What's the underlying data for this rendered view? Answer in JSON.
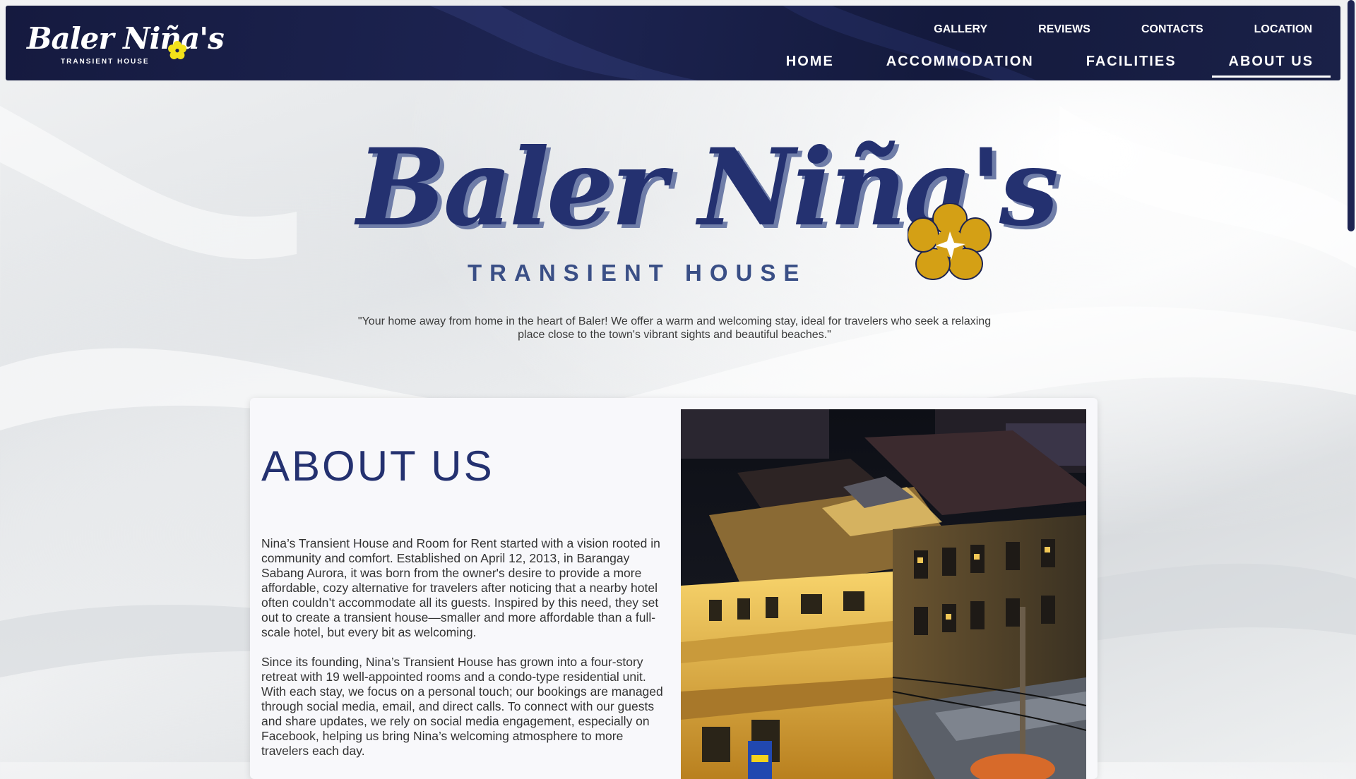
{
  "brand": {
    "small_title": "Baler Niña's",
    "small_subtitle": "TRANSIENT HOUSE",
    "hero_title": "Baler Niña's",
    "hero_subtitle": "TRANSIENT HOUSE",
    "colors": {
      "navy": "#1d2452",
      "flower": "#d4a015",
      "flower_small": "#f2e21a"
    }
  },
  "nav": {
    "top_links": [
      "GALLERY",
      "REVIEWS",
      "CONTACTS",
      "LOCATION"
    ],
    "main_links": [
      "HOME",
      "ACCOMMODATION",
      "FACILITIES",
      "ABOUT US"
    ],
    "active": "ABOUT US"
  },
  "hero": {
    "tagline": "\"Your home away from home in the heart of Baler! We offer a warm and welcoming stay, ideal for travelers who seek a relaxing place close to the town's vibrant sights and beautiful beaches.\""
  },
  "about": {
    "heading": "ABOUT US",
    "paragraph_1": "Nina’s Transient House and Room for Rent started with a vision rooted in community and comfort. Established on April 12, 2013, in Barangay Sabang Aurora, it was born from the owner's desire to provide a more affordable, cozy alternative for travelers after noticing that a nearby hotel often couldn’t accommodate all its guests. Inspired by this need, they set out to create a transient house—smaller and more affordable than a full-scale hotel, but every bit as welcoming.",
    "paragraph_2": "Since its founding, Nina’s Transient House has grown into a four-story retreat with 19 well-appointed rooms and a condo-type residential unit. With each stay, we focus on a personal touch; our bookings are managed through social media, email, and direct calls. To connect with our guests and share updates, we rely on social media engagement, especially on Facebook, helping us bring Nina’s welcoming atmosphere to more travelers each day."
  }
}
